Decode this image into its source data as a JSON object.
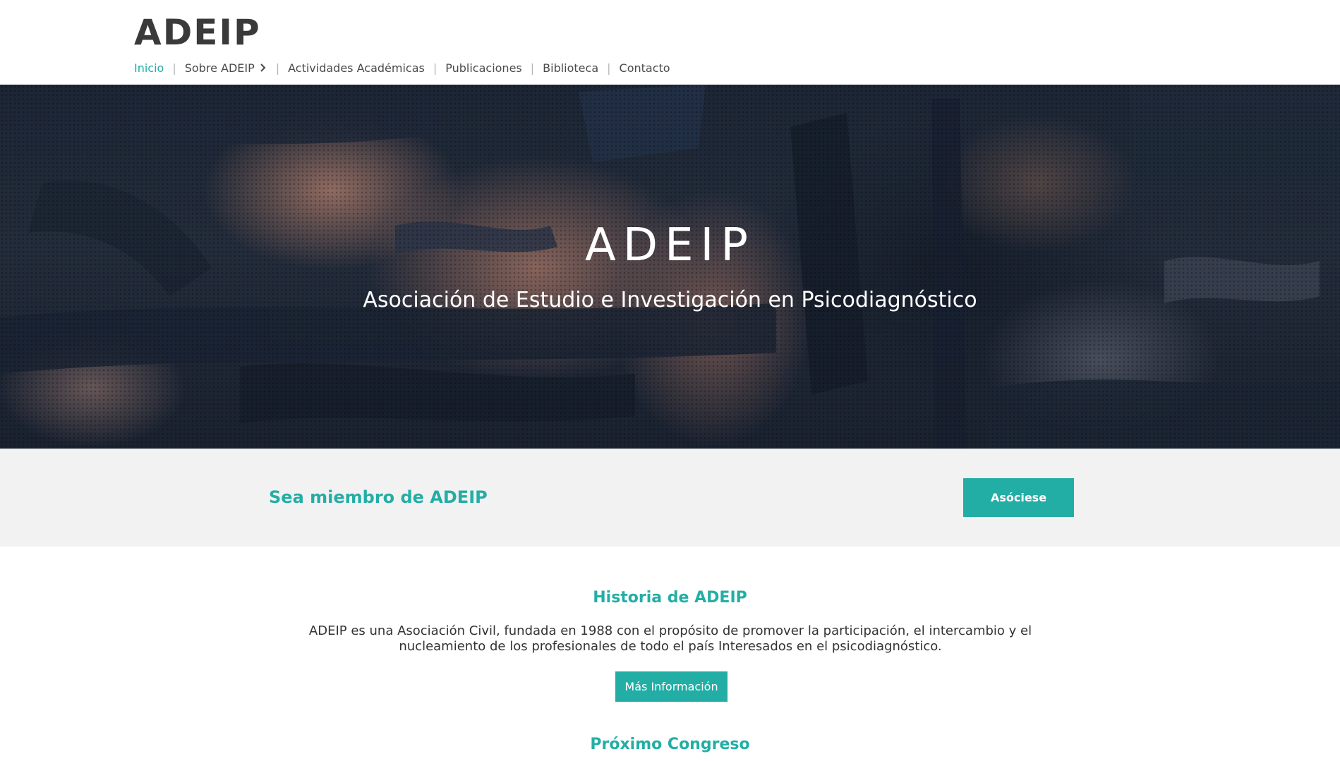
{
  "header": {
    "logo": "ADEIP",
    "nav": [
      {
        "label": "Inicio",
        "active": true
      },
      {
        "label": "Sobre ADEIP",
        "has_submenu": true
      },
      {
        "label": "Actividades Académicas"
      },
      {
        "label": "Publicaciones"
      },
      {
        "label": "Biblioteca"
      },
      {
        "label": "Contacto"
      }
    ],
    "separator": "|"
  },
  "hero": {
    "title": "ADEIP",
    "subtitle": "Asociación de Estudio e Investigación en Psicodiagnóstico"
  },
  "member": {
    "title": "Sea miembro de ADEIP",
    "button_label": "Asóciese"
  },
  "history": {
    "title": "Historia de ADEIP",
    "text_line1": "ADEIP es una Asociación Civil, fundada en 1988 con el propósito de promover la participación, el intercambio y el",
    "text_line2": "nucleamiento de los profesionales de todo el país Interesados en el psicodiagnóstico.",
    "button_label": "Más Información"
  },
  "congress": {
    "title": "Próximo Congreso"
  },
  "colors": {
    "accent": "#23aea5",
    "band_background": "#f2f2f2",
    "logo_text": "#3a3a3a",
    "nav_text": "#4a4a4a"
  },
  "icons": {
    "submenu": "chevron-right-icon"
  }
}
